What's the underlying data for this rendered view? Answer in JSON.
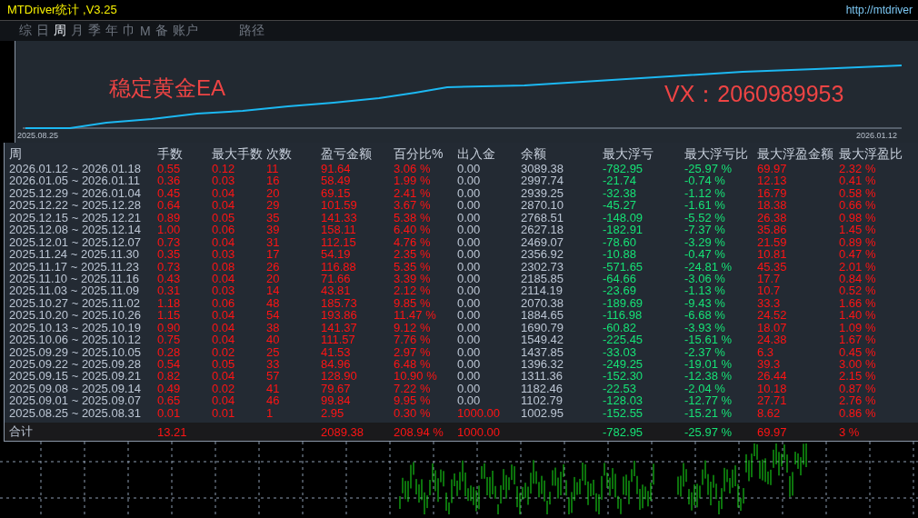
{
  "window": {
    "title": "MTDriver统计 ,V3.25",
    "url": "http://mtdriver"
  },
  "tabs": [
    {
      "label": "综",
      "selected": false
    },
    {
      "label": "日",
      "selected": false
    },
    {
      "label": "周",
      "selected": true
    },
    {
      "label": "月",
      "selected": false
    },
    {
      "label": "季",
      "selected": false
    },
    {
      "label": "年",
      "selected": false
    },
    {
      "label": "巾",
      "selected": false
    },
    {
      "label": "M",
      "selected": false
    },
    {
      "label": "备",
      "selected": false
    },
    {
      "label": "账户",
      "selected": false
    },
    {
      "label": "路径",
      "selected": false
    }
  ],
  "chart": {
    "start_label": "2025.08.25",
    "end_label": "2026.01.12",
    "captions": [
      "稳定黄金EA",
      "VX：2060989953"
    ]
  },
  "table": {
    "columns": [
      {
        "label": "周",
        "kind": "neutral"
      },
      {
        "label": "手数",
        "kind": "gain"
      },
      {
        "label": "最大手数",
        "kind": "gain"
      },
      {
        "label": "次数",
        "kind": "gain"
      },
      {
        "label": "盈亏金额",
        "kind": "gain"
      },
      {
        "label": "百分比%",
        "kind": "gain"
      },
      {
        "label": "出入金",
        "kind": "deposit"
      },
      {
        "label": "余额",
        "kind": "neutral"
      },
      {
        "label": "最大浮亏",
        "kind": "loss"
      },
      {
        "label": "最大浮亏比",
        "kind": "loss"
      },
      {
        "label": "最大浮盈金额",
        "kind": "gain"
      },
      {
        "label": "最大浮盈比",
        "kind": "gain"
      }
    ],
    "rows": [
      {
        "cells": [
          "2026.01.12 ~ 2026.01.18",
          "0.55",
          "0.12",
          "11",
          "91.64",
          "3.06 %",
          "0.00",
          "3089.38",
          "-782.95",
          "-25.97 %",
          "69.97",
          "2.32 %"
        ],
        "deposit_marked": false
      },
      {
        "cells": [
          "2026.01.05 ~ 2026.01.11",
          "0.36",
          "0.03",
          "16",
          "58.49",
          "1.99 %",
          "0.00",
          "2997.74",
          "-21.74",
          "-0.74 %",
          "12.13",
          "0.41 %"
        ],
        "deposit_marked": false
      },
      {
        "cells": [
          "2025.12.29 ~ 2026.01.04",
          "0.45",
          "0.04",
          "20",
          "69.15",
          "2.41 %",
          "0.00",
          "2939.25",
          "-32.38",
          "-1.12 %",
          "16.79",
          "0.58 %"
        ],
        "deposit_marked": false
      },
      {
        "cells": [
          "2025.12.22 ~ 2025.12.28",
          "0.64",
          "0.04",
          "29",
          "101.59",
          "3.67 %",
          "0.00",
          "2870.10",
          "-45.27",
          "-1.61 %",
          "18.38",
          "0.66 %"
        ],
        "deposit_marked": false
      },
      {
        "cells": [
          "2025.12.15 ~ 2025.12.21",
          "0.89",
          "0.05",
          "35",
          "141.33",
          "5.38 %",
          "0.00",
          "2768.51",
          "-148.09",
          "-5.52 %",
          "26.38",
          "0.98 %"
        ],
        "deposit_marked": false
      },
      {
        "cells": [
          "2025.12.08 ~ 2025.12.14",
          "1.00",
          "0.06",
          "39",
          "158.11",
          "6.40 %",
          "0.00",
          "2627.18",
          "-182.91",
          "-7.37 %",
          "35.86",
          "1.45 %"
        ],
        "deposit_marked": false
      },
      {
        "cells": [
          "2025.12.01 ~ 2025.12.07",
          "0.73",
          "0.04",
          "31",
          "112.15",
          "4.76 %",
          "0.00",
          "2469.07",
          "-78.60",
          "-3.29 %",
          "21.59",
          "0.89 %"
        ],
        "deposit_marked": false
      },
      {
        "cells": [
          "2025.11.24 ~ 2025.11.30",
          "0.35",
          "0.03",
          "17",
          "54.19",
          "2.35 %",
          "0.00",
          "2356.92",
          "-10.88",
          "-0.47 %",
          "10.81",
          "0.47 %"
        ],
        "deposit_marked": false
      },
      {
        "cells": [
          "2025.11.17 ~ 2025.11.23",
          "0.73",
          "0.08",
          "26",
          "116.88",
          "5.35 %",
          "0.00",
          "2302.73",
          "-571.65",
          "-24.81 %",
          "45.35",
          "2.01 %"
        ],
        "deposit_marked": false
      },
      {
        "cells": [
          "2025.11.10 ~ 2025.11.16",
          "0.43",
          "0.04",
          "20",
          "71.66",
          "3.39 %",
          "0.00",
          "2185.85",
          "-64.66",
          "-3.06 %",
          "17.7",
          "0.84 %"
        ],
        "deposit_marked": false
      },
      {
        "cells": [
          "2025.11.03 ~ 2025.11.09",
          "0.31",
          "0.03",
          "14",
          "43.81",
          "2.12 %",
          "0.00",
          "2114.19",
          "-23.69",
          "-1.13 %",
          "10.7",
          "0.52 %"
        ],
        "deposit_marked": false
      },
      {
        "cells": [
          "2025.10.27 ~ 2025.11.02",
          "1.18",
          "0.06",
          "48",
          "185.73",
          "9.85 %",
          "0.00",
          "2070.38",
          "-189.69",
          "-9.43 %",
          "33.3",
          "1.66 %"
        ],
        "deposit_marked": false
      },
      {
        "cells": [
          "2025.10.20 ~ 2025.10.26",
          "1.15",
          "0.04",
          "54",
          "193.86",
          "11.47 %",
          "0.00",
          "1884.65",
          "-116.98",
          "-6.68 %",
          "24.52",
          "1.40 %"
        ],
        "deposit_marked": false
      },
      {
        "cells": [
          "2025.10.13 ~ 2025.10.19",
          "0.90",
          "0.04",
          "38",
          "141.37",
          "9.12 %",
          "0.00",
          "1690.79",
          "-60.82",
          "-3.93 %",
          "18.07",
          "1.09 %"
        ],
        "deposit_marked": false
      },
      {
        "cells": [
          "2025.10.06 ~ 2025.10.12",
          "0.75",
          "0.04",
          "40",
          "111.57",
          "7.76 %",
          "0.00",
          "1549.42",
          "-225.45",
          "-15.61 %",
          "24.38",
          "1.67 %"
        ],
        "deposit_marked": false
      },
      {
        "cells": [
          "2025.09.29 ~ 2025.10.05",
          "0.28",
          "0.02",
          "25",
          "41.53",
          "2.97 %",
          "0.00",
          "1437.85",
          "-33.03",
          "-2.37 %",
          "6.3",
          "0.45 %"
        ],
        "deposit_marked": false
      },
      {
        "cells": [
          "2025.09.22 ~ 2025.09.28",
          "0.54",
          "0.05",
          "33",
          "84.96",
          "6.48 %",
          "0.00",
          "1396.32",
          "-249.25",
          "-19.01 %",
          "39.3",
          "3.00 %"
        ],
        "deposit_marked": false
      },
      {
        "cells": [
          "2025.09.15 ~ 2025.09.21",
          "0.82",
          "0.04",
          "57",
          "128.90",
          "10.90 %",
          "0.00",
          "1311.36",
          "-152.30",
          "-12.38 %",
          "26.44",
          "2.15 %"
        ],
        "deposit_marked": false
      },
      {
        "cells": [
          "2025.09.08 ~ 2025.09.14",
          "0.49",
          "0.02",
          "41",
          "79.67",
          "7.22 %",
          "0.00",
          "1182.46",
          "-22.53",
          "-2.04 %",
          "10.18",
          "0.87 %"
        ],
        "deposit_marked": false
      },
      {
        "cells": [
          "2025.09.01 ~ 2025.09.07",
          "0.65",
          "0.04",
          "46",
          "99.84",
          "9.95 %",
          "0.00",
          "1102.79",
          "-128.03",
          "-12.77 %",
          "27.71",
          "2.76 %"
        ],
        "deposit_marked": false
      },
      {
        "cells": [
          "2025.08.25 ~ 2025.08.31",
          "0.01",
          "0.01",
          "1",
          "2.95",
          "0.30 %",
          "1000.00",
          "1002.95",
          "-152.55",
          "-15.21 %",
          "8.62",
          "0.86 %"
        ],
        "deposit_marked": true
      }
    ],
    "total": {
      "cells": [
        "合计",
        "13.21",
        null,
        null,
        "2089.38",
        "208.94 %",
        "1000.00",
        null,
        "-782.95",
        "-25.97 %",
        "69.97",
        "3 %"
      ],
      "deposit_marked": true
    }
  }
}
